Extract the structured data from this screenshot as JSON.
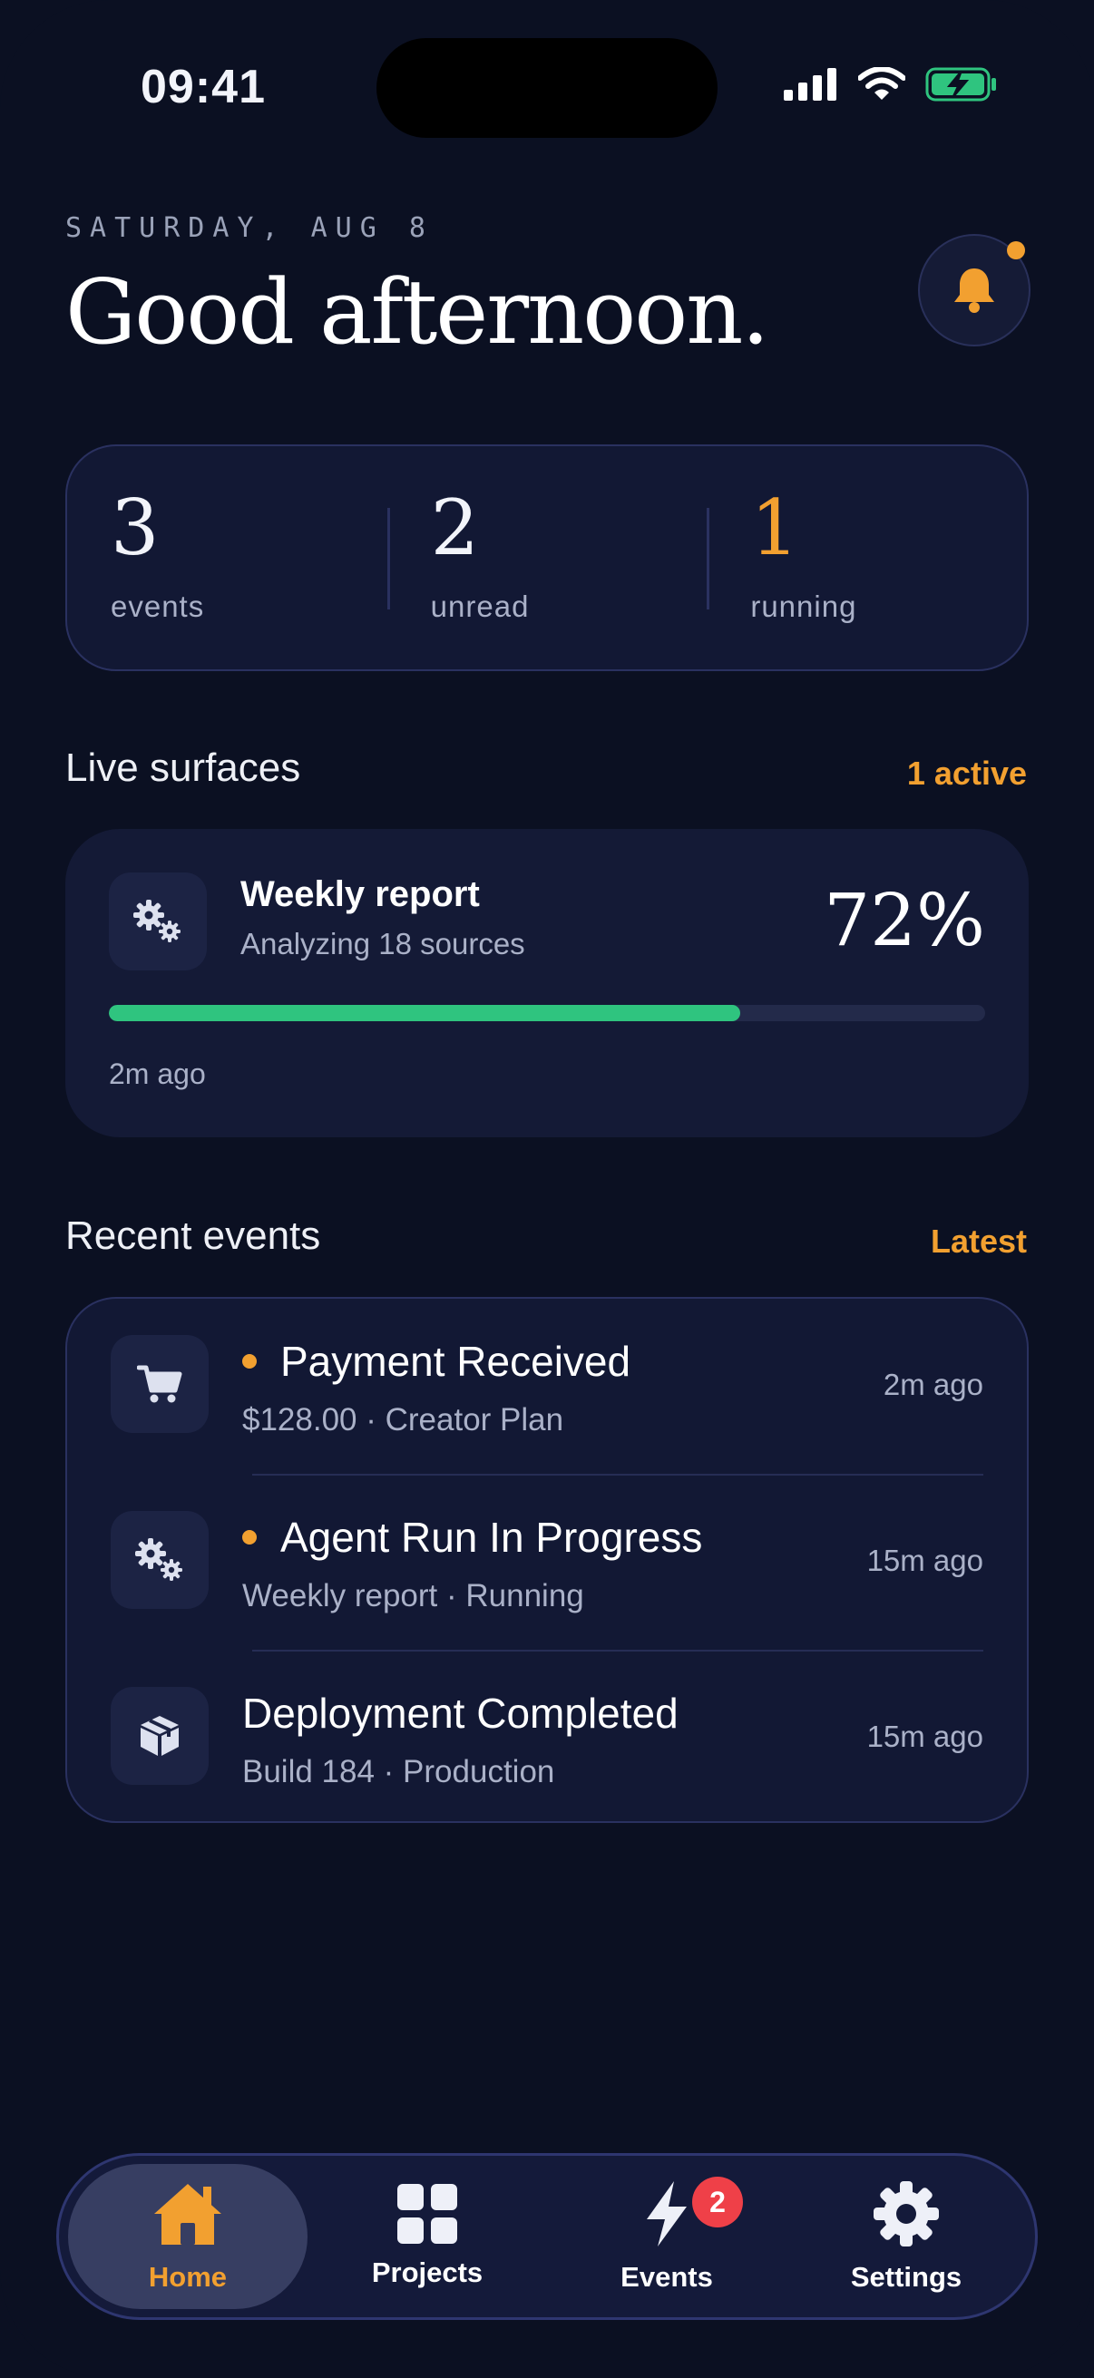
{
  "status_bar": {
    "time": "09:41"
  },
  "header": {
    "date": "SATURDAY, AUG 8",
    "greeting": "Good afternoon."
  },
  "stats": [
    {
      "value": "3",
      "label": "events"
    },
    {
      "value": "2",
      "label": "unread"
    },
    {
      "value": "1",
      "label": "running"
    }
  ],
  "live": {
    "section_title": "Live surfaces",
    "section_link": "1 active",
    "card": {
      "title": "Weekly report",
      "subtitle": "Analyzing 18 sources",
      "percent_label": "72%",
      "progress": 0.72,
      "time": "2m ago",
      "icon": "gears-icon"
    }
  },
  "recent": {
    "section_title": "Recent events",
    "section_link": "Latest",
    "items": [
      {
        "title": "Payment Received",
        "subtitle": "$128.00 · Creator Plan",
        "time": "2m ago",
        "unread": true,
        "icon": "cart-icon"
      },
      {
        "title": "Agent Run In Progress",
        "subtitle": "Weekly report · Running",
        "time": "15m ago",
        "unread": true,
        "icon": "gears-icon"
      },
      {
        "title": "Deployment Completed",
        "subtitle": "Build 184 · Production",
        "time": "15m ago",
        "unread": false,
        "icon": "box-icon"
      }
    ]
  },
  "tab_bar": {
    "tabs": [
      {
        "label": "Home",
        "icon": "home-icon",
        "active": true
      },
      {
        "label": "Projects",
        "icon": "grid-icon",
        "active": false
      },
      {
        "label": "Events",
        "icon": "bolt-icon",
        "active": false,
        "badge": "2"
      },
      {
        "label": "Settings",
        "icon": "gear-icon",
        "active": false
      }
    ]
  },
  "colors": {
    "background": "#0b1022",
    "card": "#121834",
    "accent": "#f2a030",
    "progress": "#2fc47f",
    "badge": "#ef4048"
  }
}
